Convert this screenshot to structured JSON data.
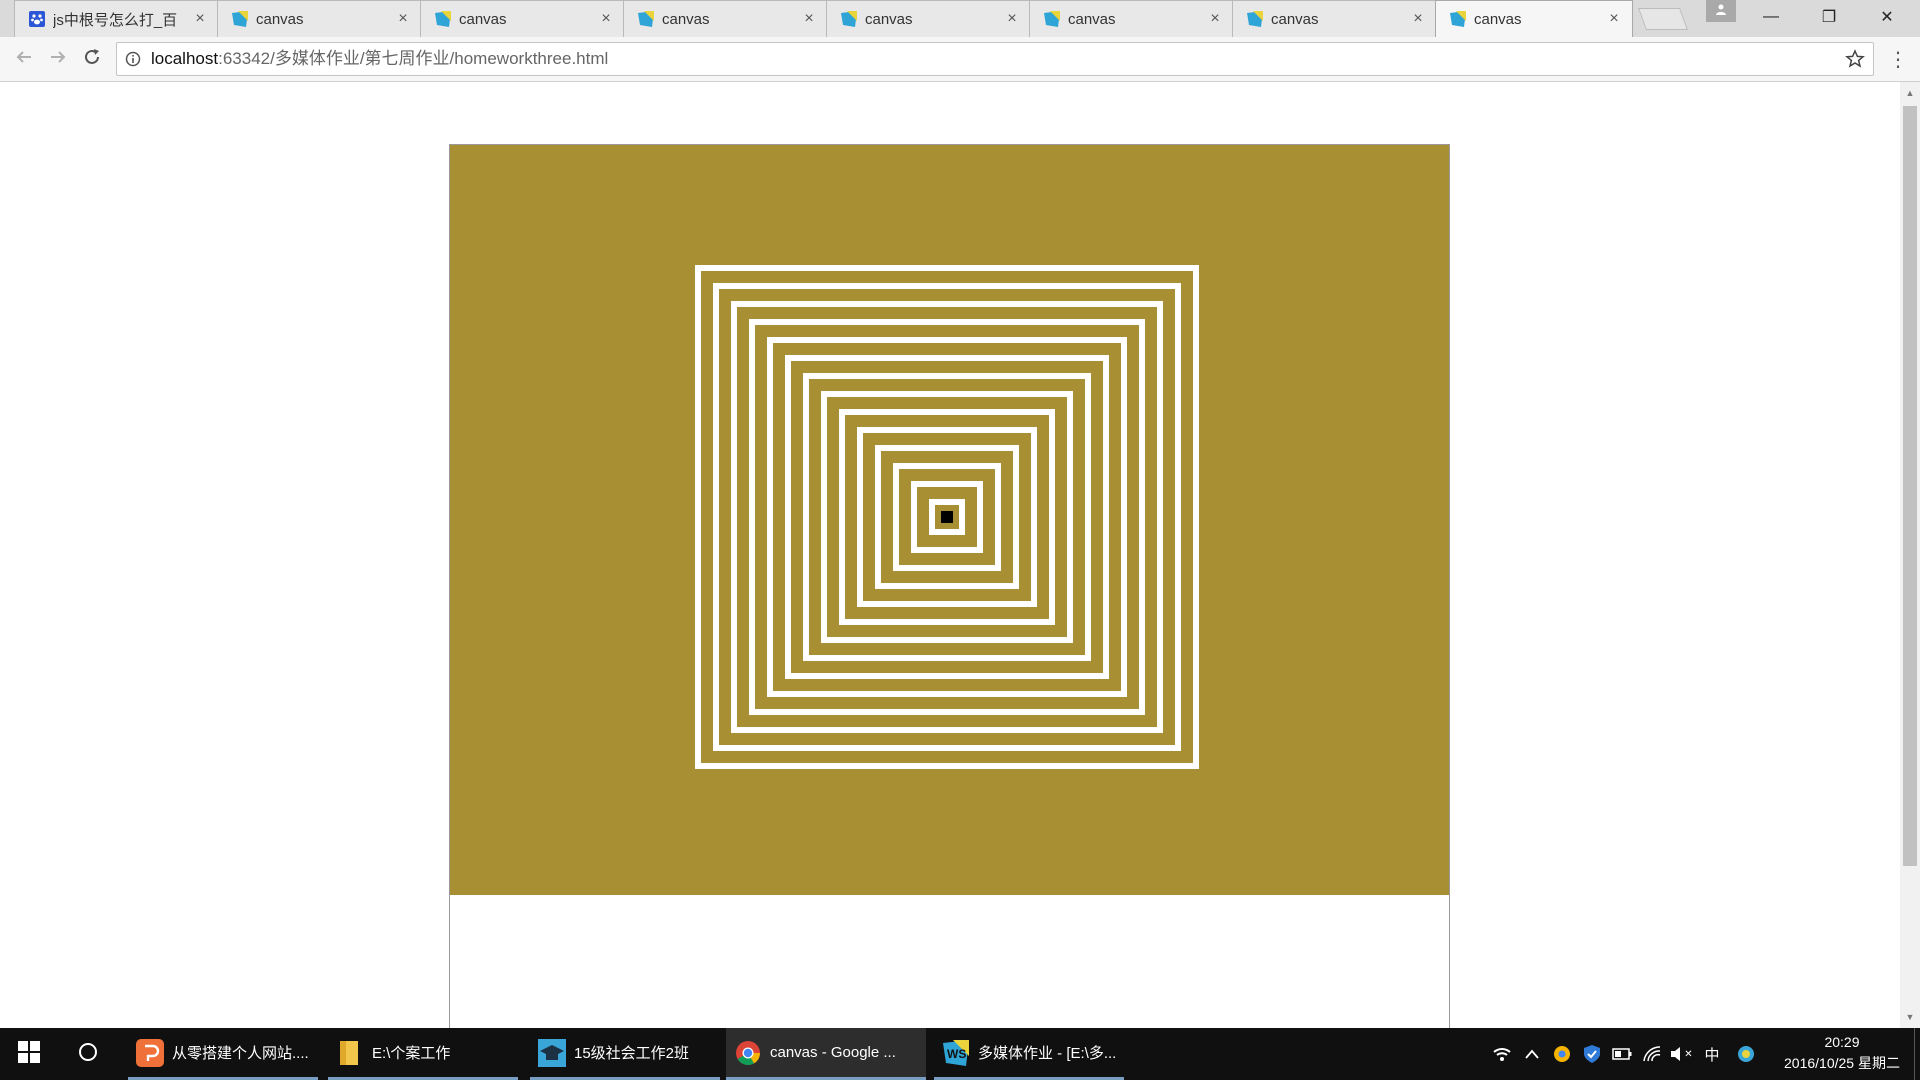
{
  "browser": {
    "tabs": [
      {
        "title": "js中根号怎么打_百",
        "icon": "baidu-paw-icon"
      },
      {
        "title": "canvas",
        "icon": "webstorm-icon"
      },
      {
        "title": "canvas",
        "icon": "webstorm-icon"
      },
      {
        "title": "canvas",
        "icon": "webstorm-icon"
      },
      {
        "title": "canvas",
        "icon": "webstorm-icon"
      },
      {
        "title": "canvas",
        "icon": "webstorm-icon"
      },
      {
        "title": "canvas",
        "icon": "webstorm-icon"
      },
      {
        "title": "canvas",
        "icon": "webstorm-icon",
        "active": true
      }
    ],
    "close_glyph": "×",
    "window_controls": {
      "minimize": "—",
      "restore": "❐",
      "close": "✕"
    },
    "address": {
      "host": "localhost",
      "rest": ":63342/多媒体作业/第七周作业/homeworkthree.html"
    },
    "menu_glyph": "⋮"
  },
  "page": {
    "canvas_background": "#a88f33",
    "square_stroke": "#ffffff",
    "center_block": "#000000",
    "concentric_squares": 14
  },
  "taskbar": {
    "items": [
      {
        "label": "从零搭建个人网站....",
        "icon": "wps-presentation-icon",
        "active": false
      },
      {
        "label": "E:\\个案工作",
        "icon": "folder-icon",
        "active": false
      },
      {
        "label": "15级社会工作2班",
        "icon": "graduation-cap-icon",
        "active": false
      },
      {
        "label": "canvas - Google ...",
        "icon": "chrome-icon",
        "active": true
      },
      {
        "label": "多媒体作业 - [E:\\多...",
        "icon": "webstorm-icon",
        "active": false
      }
    ],
    "tray": {
      "ime": "中",
      "mute_glyph": "✕"
    },
    "clock": {
      "time": "20:29",
      "date": "2016/10/25 星期二"
    }
  }
}
